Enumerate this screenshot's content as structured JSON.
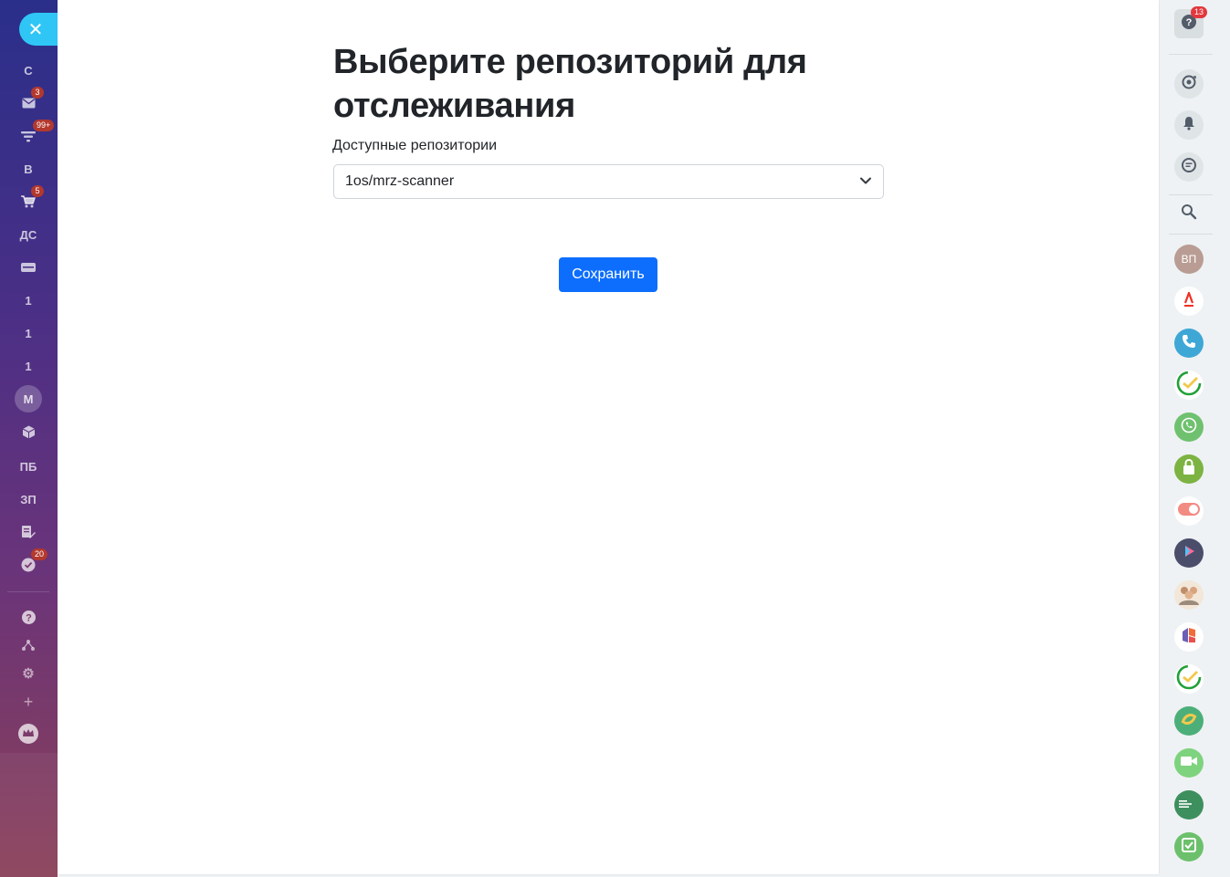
{
  "main": {
    "title": "Выберите репозиторий для отслеживания",
    "field_label": "Доступные репозитории",
    "selected_repository": "1os/mrz-scanner",
    "save_label": "Сохранить"
  },
  "left_sidebar": {
    "items": [
      {
        "label": "С"
      },
      {
        "icon": "mail-icon",
        "badge": "3"
      },
      {
        "icon": "filter-icon",
        "badge": "99+"
      },
      {
        "label": "В"
      },
      {
        "icon": "cart-icon",
        "badge": "5"
      },
      {
        "label": "ДС"
      },
      {
        "icon": "inbox-icon"
      },
      {
        "label": "1"
      },
      {
        "label": "1"
      },
      {
        "label": "1"
      },
      {
        "avatar": "М"
      },
      {
        "icon": "box-icon"
      },
      {
        "label": "ПБ"
      },
      {
        "label": "ЗП"
      },
      {
        "icon": "edit-document-icon"
      },
      {
        "icon": "check-circle-icon",
        "badge": "20"
      },
      {
        "icon": "help-icon"
      },
      {
        "icon": "sitemap-icon"
      },
      {
        "icon": "gear-icon"
      },
      {
        "icon": "plus-icon"
      },
      {
        "icon": "crown-icon"
      }
    ]
  },
  "right_panel": {
    "help_badge": "13",
    "avatar_initials": "ВП",
    "colors": {
      "primary": "#0d6efd",
      "accent_cyan": "#2fc6f6",
      "badge_red": "#e2383d"
    }
  }
}
